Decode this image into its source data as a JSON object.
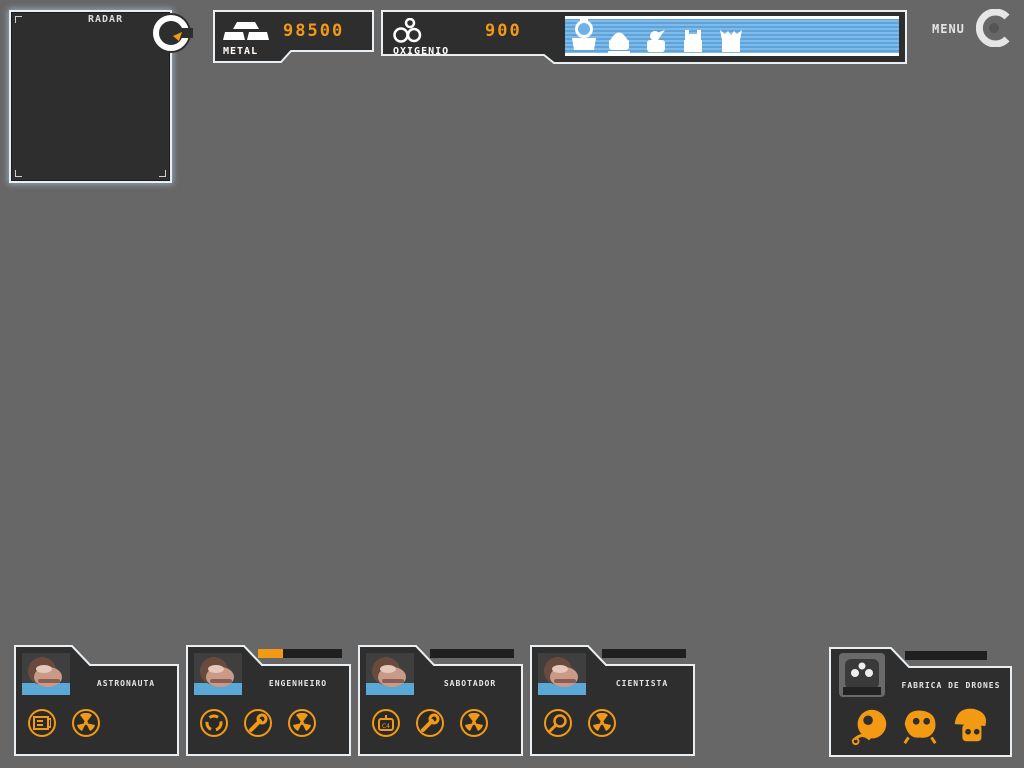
{
  "radar": {
    "label": "RADAR"
  },
  "resources": {
    "metal": {
      "label": "METAL",
      "value": "98500"
    },
    "oxygen": {
      "label": "OXIGENIO",
      "value": "900"
    },
    "oxygen_units": [
      "astronaut-unit-icon",
      "alien-unit-icon",
      "bird-unit-icon",
      "robot-unit-icon",
      "crab-unit-icon"
    ]
  },
  "menu": {
    "label": "MENU"
  },
  "colors": {
    "accent": "#f39a14",
    "panel": "#2e2e2e",
    "frame": "#e8eef2",
    "oxygen_bar": "#6fb2e8",
    "background": "#676767"
  },
  "cards": [
    {
      "name": "ASTRONAUTA",
      "progress": 0,
      "icons": [
        "badge-icon",
        "radiation-icon"
      ]
    },
    {
      "name": "ENGENHEIRO",
      "progress": 0.3,
      "icons": [
        "recycle-icon",
        "wrench-icon",
        "radiation-icon"
      ]
    },
    {
      "name": "SABOTADOR",
      "progress": 0,
      "icons": [
        "c4-bomb-icon",
        "wrench-icon",
        "radiation-icon"
      ]
    },
    {
      "name": "CIENTISTA",
      "progress": 0,
      "icons": [
        "magnifier-icon",
        "radiation-icon"
      ]
    }
  ],
  "drone_factory": {
    "name": "FABRICA DE DRONES",
    "progress": 0,
    "icons": [
      "drone-blob-icon",
      "drone-crab-icon",
      "drone-mushroom-icon"
    ]
  }
}
